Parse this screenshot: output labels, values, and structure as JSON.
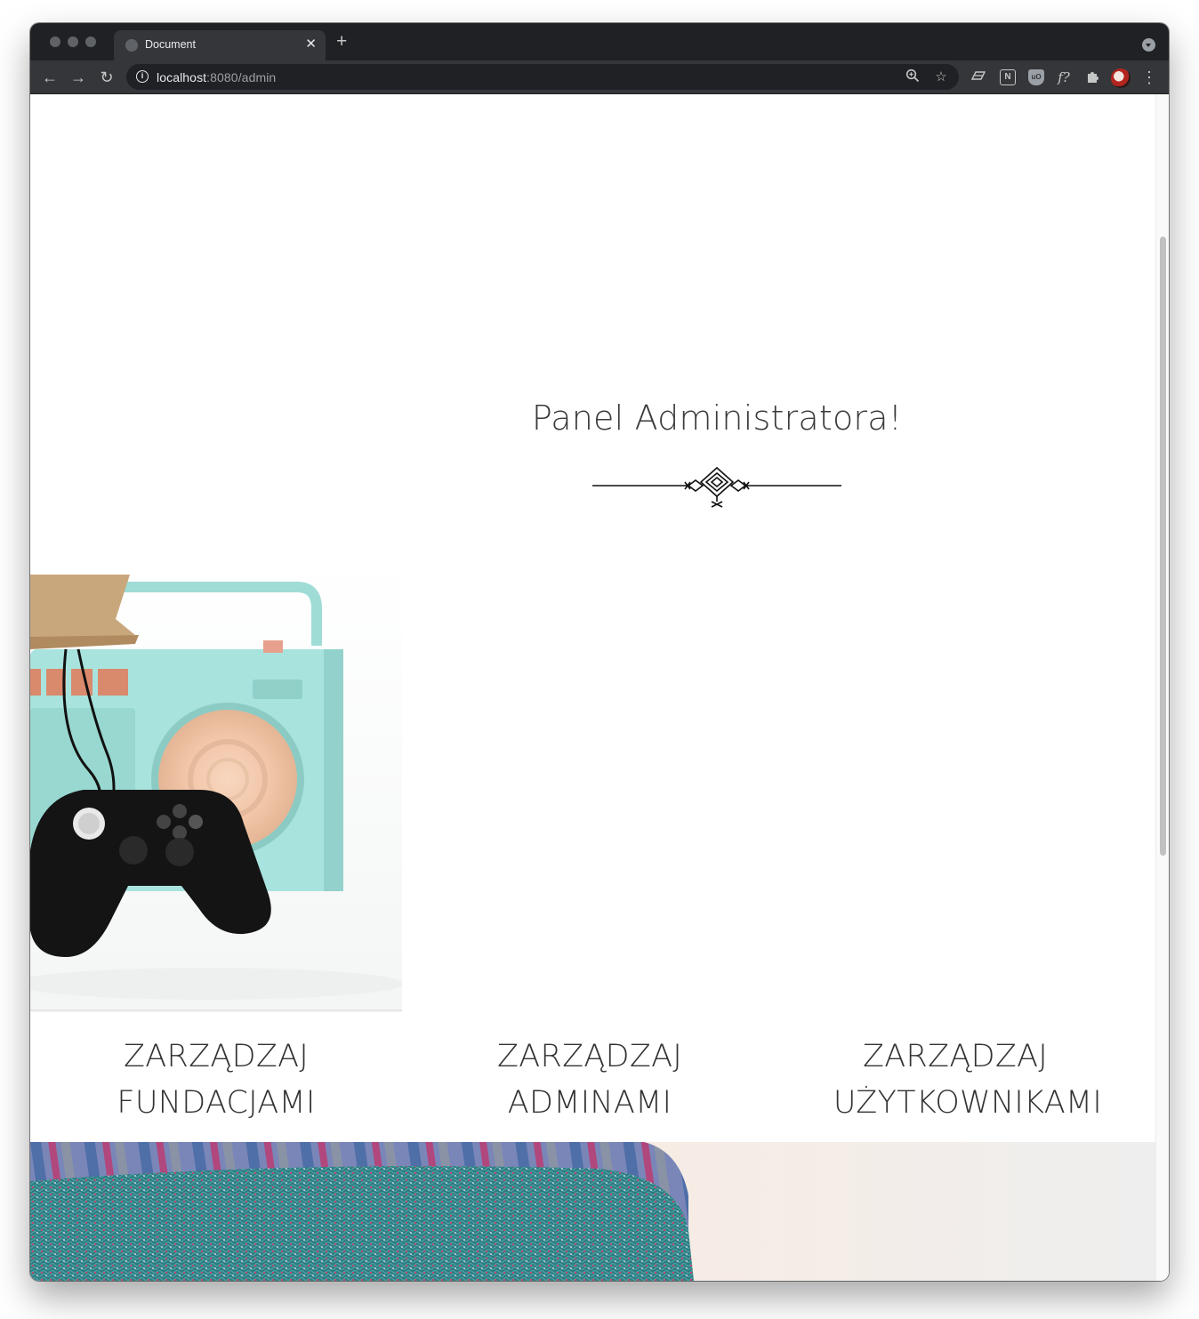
{
  "browser": {
    "tab_title": "Document",
    "tab_close": "✕",
    "new_tab": "+",
    "url_host": "localhost",
    "url_rest": ":8080/admin",
    "icons": [
      "back-icon",
      "forward-icon",
      "reload-icon",
      "info-icon",
      "zoom-icon",
      "bookmark-star-icon",
      "extension-icon",
      "notion-icon",
      "ublock-icon",
      "font-icon",
      "puzzle-icon",
      "profile-avatar",
      "menu-icon"
    ],
    "ext_font_label": "f?",
    "ext_notion_label": "N",
    "ext_ublock_label": "uO"
  },
  "page": {
    "headline": "Panel Administratora!",
    "cards": [
      {
        "line1": "ZARZĄDZAJ",
        "line2": "FUNDACJAMI"
      },
      {
        "line1": "ZARZĄDZAJ",
        "line2": "ADMINAMI"
      },
      {
        "line1": "ZARZĄDZAJ",
        "line2": "UŻYTKOWNIKAMI"
      }
    ]
  },
  "colors": {
    "chrome_dark": "#202124",
    "chrome_toolbar": "#35363a",
    "text_main": "#333333",
    "mint": "#a8e3de"
  }
}
